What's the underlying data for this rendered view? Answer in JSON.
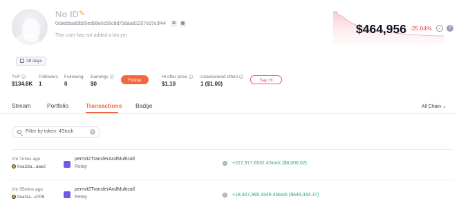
{
  "profile": {
    "name": "No ID",
    "address": "0xbebbad0b95ed88e6c56c8d79daa82257e97c3f44",
    "bio": "This user has not added a bio yet",
    "badge_days": "28 days"
  },
  "price": {
    "value": "$464,956",
    "change": "-25.04%"
  },
  "stats": {
    "tvf_label": "TVF",
    "tvf_value": "$134.8K",
    "followers_label": "Followers",
    "followers_value": "1",
    "following_label": "Following",
    "following_value": "0",
    "earnings_label": "Earnings",
    "earnings_value": "$0",
    "hi_offer_label": "Hi offer price",
    "hi_offer_value": "$1.10",
    "unanswered_label": "Unanswered offers",
    "unanswered_value": "1 ($1.00)"
  },
  "buttons": {
    "follow": "Follow",
    "say_hi": "Say Hi"
  },
  "tabs": [
    "Stream",
    "Portfolio",
    "Transactions",
    "Badge"
  ],
  "active_tab": "Transactions",
  "chain_select": "All Chain",
  "filter": {
    "text": "Filter by token: 4Stock"
  },
  "transactions": [
    {
      "time": "1hr 7mins ago",
      "address": "0xa2da...aae2",
      "method": "permit2TransferAndMulticall",
      "via": "Relay",
      "amount": "+227,977.6532 4Stock ($8,006.02)"
    },
    {
      "time": "1hr 55mins ago",
      "address": "0xaf1a...e705",
      "method": "permit2TransferAndMulticall",
      "via": "Relay",
      "amount": "+18,407,995.4348 4Stock ($646,444.37)"
    }
  ],
  "colors": {
    "accent": "#f2673f",
    "negative": "#e0424f",
    "positive": "#2aa876",
    "sayhi": "#e64a9b"
  }
}
